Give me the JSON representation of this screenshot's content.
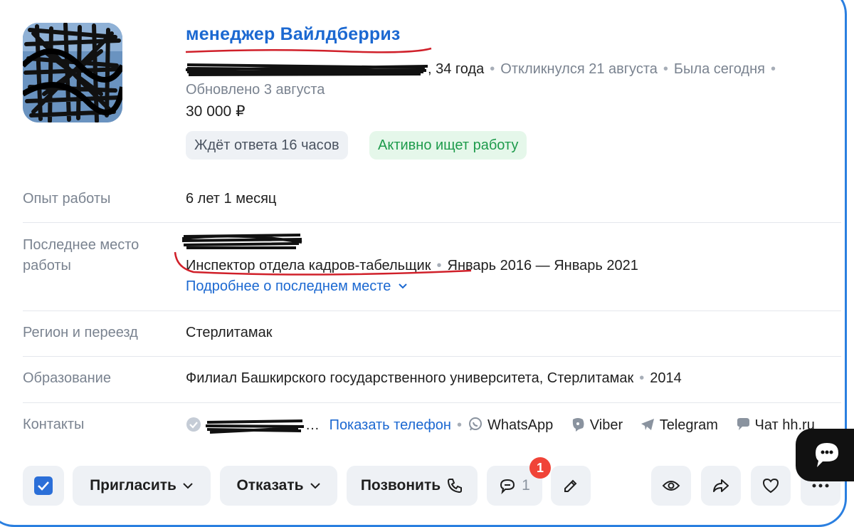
{
  "header": {
    "title": "менеджер Вайлдберриз",
    "age": ", 34 года",
    "responded": "Откликнулся 21 августа",
    "last_seen": "Была сегодня",
    "updated": "Обновлено 3 августа",
    "salary": "30 000 ₽",
    "badge_waiting": "Ждёт ответа 16 часов",
    "badge_active": "Активно ищет работу"
  },
  "rows": {
    "experience": {
      "label": "Опыт работы",
      "value": "6 лет 1 месяц"
    },
    "last_job": {
      "label": "Последнее место работы",
      "position": "Инспектор отдела кадров-табельщик",
      "period": "Январь 2016 — Январь 2021",
      "more_link": "Подробнее о последнем месте"
    },
    "region": {
      "label": "Регион и переезд",
      "value": "Стерлитамак"
    },
    "education": {
      "label": "Образование",
      "value": "Филиал Башкирского государственного университета, Стерлитамак",
      "year": "2014"
    },
    "contacts": {
      "label": "Контакты",
      "phone_suffix": "…",
      "show_phone": "Показать телефон",
      "whatsapp": "WhatsApp",
      "viber": "Viber",
      "telegram": "Telegram",
      "chat": "Чат hh.ru"
    }
  },
  "toolbar": {
    "invite": "Пригласить",
    "reject": "Отказать",
    "call": "Позвонить",
    "comments_count": "1",
    "notification_count": "1"
  },
  "colors": {
    "link": "#1b68d1",
    "border": "#2a7fe0",
    "active_green": "#1e9b4c",
    "checkbox": "#2b6fd8",
    "badge_red": "#f04438"
  }
}
